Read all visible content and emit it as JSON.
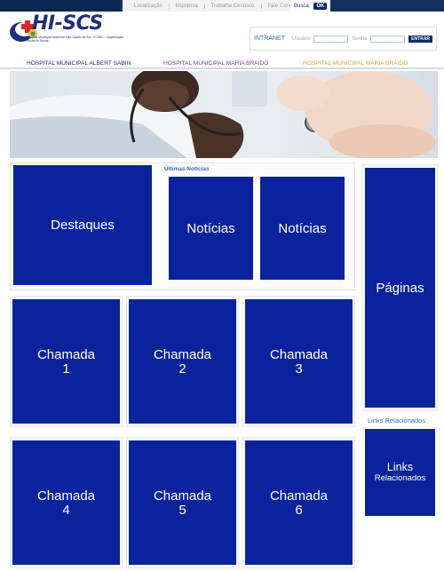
{
  "topnav": {
    "items": [
      "Localização",
      "Imprensa",
      "Trabalhe Conosco",
      "Fale Conosco"
    ],
    "search_label": "Busca:",
    "search_button": "OK"
  },
  "logo": {
    "name": "HI-SCS",
    "subtitle": "Hospital Municipal Infantil de São Camilo do Sul · FCSSC - Organização Social de Saúde"
  },
  "intranet": {
    "label": "INTRANET",
    "user_label": "Usuário",
    "password_label": "Senha",
    "submit_label": "ENTRAR"
  },
  "hospitals": [
    "HOSPITAL MUNICIPAL ALBERT SABIN",
    "HOSPITAL MUNICIPAL MARIA BRAIDO",
    "HOSPITAL MUNICIPAL MARIA BRAIDO"
  ],
  "colors": {
    "block": "#0a239d",
    "navy": "#13315f",
    "accent_blue": "#3a6fb0",
    "purple": "#7a3c8e",
    "gold": "#c9a93d"
  },
  "main": {
    "destaques": "Destaques",
    "ultimas_label": "Últimas Notícias",
    "noticias": [
      "Notícias",
      "Notícias"
    ],
    "paginas": "Páginas",
    "chamadas": [
      {
        "title": "Chamada",
        "num": "1"
      },
      {
        "title": "Chamada",
        "num": "2"
      },
      {
        "title": "Chamada",
        "num": "3"
      },
      {
        "title": "Chamada",
        "num": "4"
      },
      {
        "title": "Chamada",
        "num": "5"
      },
      {
        "title": "Chamada",
        "num": "6"
      }
    ],
    "links_label": "Links Relacionados",
    "links_title": "Links",
    "links_sub": "Relacionados"
  }
}
